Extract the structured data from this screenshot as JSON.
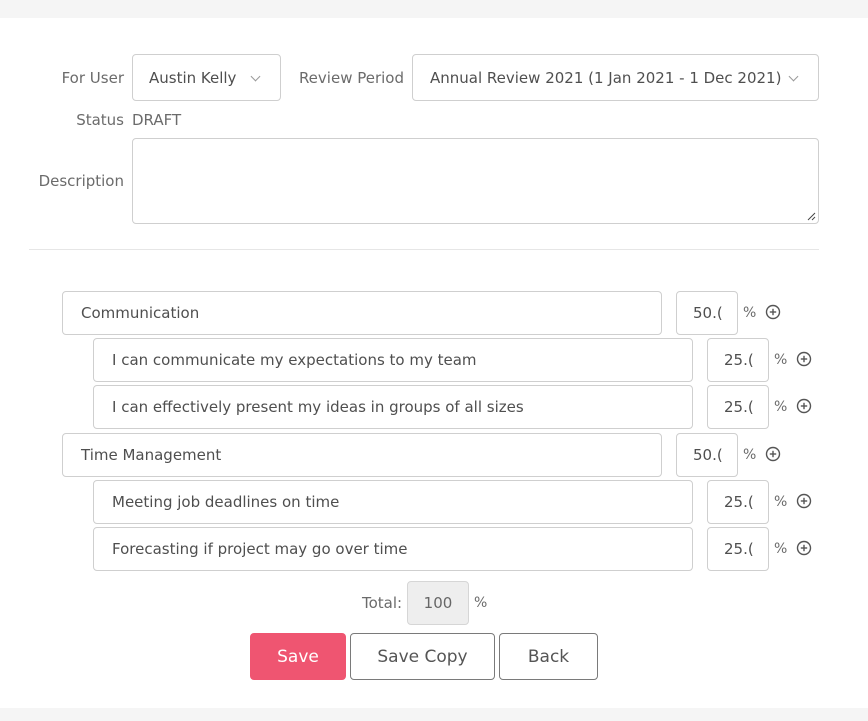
{
  "form": {
    "for_user_label": "For User",
    "for_user_value": "Austin Kelly",
    "review_period_label": "Review Period",
    "review_period_value": "Annual Review 2021 (1 Jan 2021 - 1 Dec 2021)",
    "status_label": "Status",
    "status_value": "DRAFT",
    "description_label": "Description",
    "description_value": ""
  },
  "rows": [
    {
      "name": "Communication",
      "weight": "50.(",
      "unit": "%"
    },
    {
      "name": "I can communicate my expectations to my team",
      "weight": "25.(",
      "unit": "%"
    },
    {
      "name": "I can effectively present my ideas in groups of all sizes",
      "weight": "25.(",
      "unit": "%"
    },
    {
      "name": "Time Management",
      "weight": "50.(",
      "unit": "%"
    },
    {
      "name": "Meeting job deadlines on time",
      "weight": "25.(",
      "unit": "%"
    },
    {
      "name": "Forecasting if project may go over time",
      "weight": "25.(",
      "unit": "%"
    }
  ],
  "total": {
    "label": "Total:",
    "value": "100",
    "unit": "%"
  },
  "buttons": {
    "save": "Save",
    "save_copy": "Save Copy",
    "back": "Back"
  },
  "colors": {
    "primary": "#ef5571"
  },
  "icons": {
    "row_action": "plus-circle-icon",
    "select": "chevron-down-icon"
  }
}
